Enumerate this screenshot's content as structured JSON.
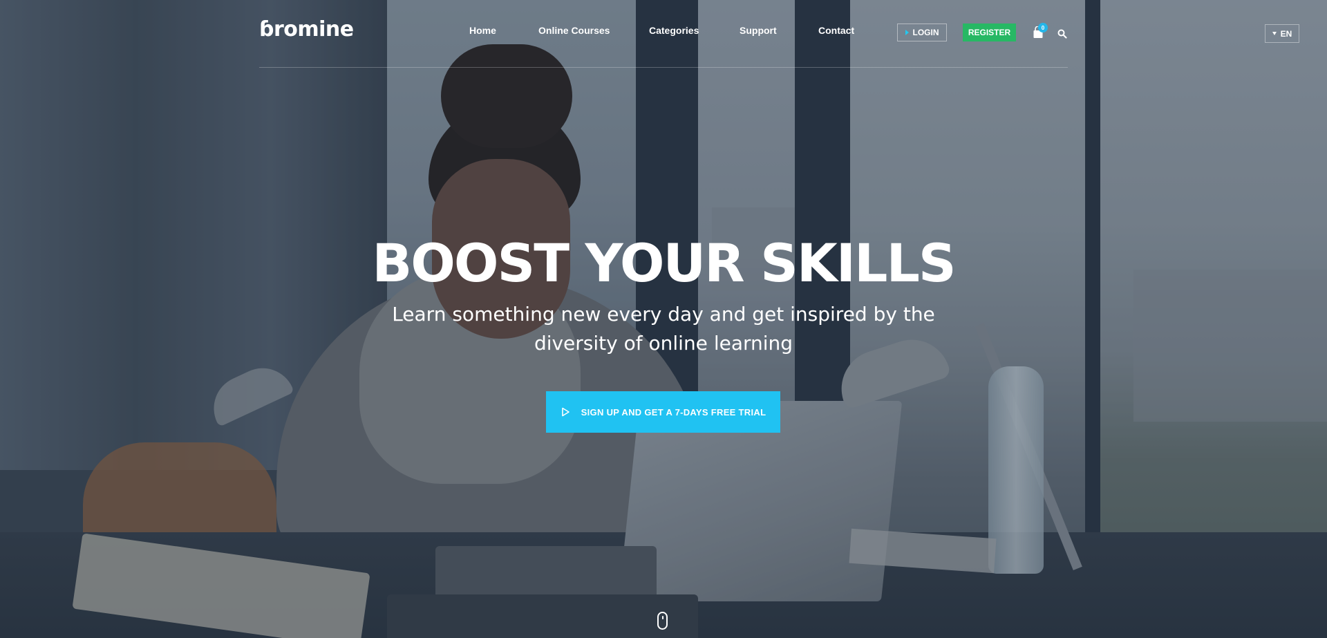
{
  "brand": {
    "logo_text": "ɓromine"
  },
  "nav": {
    "items": [
      {
        "label": "Home"
      },
      {
        "label": "Online Courses"
      },
      {
        "label": "Categories"
      },
      {
        "label": "Support"
      },
      {
        "label": "Contact"
      }
    ]
  },
  "header_actions": {
    "login_label": "LOGIN",
    "register_label": "REGISTER",
    "cart_count": "0",
    "cart_icon": "shopping-bag-icon",
    "search_icon": "search-icon",
    "language_label": "EN"
  },
  "hero": {
    "title": "BOOST YOUR SKILLS",
    "subtitle": "Learn something new every day and get inspired by the diversity of online learning",
    "cta_label": "SIGN UP AND GET A 7-DAYS FREE TRIAL",
    "cta_icon": "play-icon",
    "scroll_icon": "mouse-scroll-icon"
  },
  "colors": {
    "register_green": "#27b864",
    "cta_blue": "#20c2f2",
    "badge_blue": "#24b6e9"
  }
}
